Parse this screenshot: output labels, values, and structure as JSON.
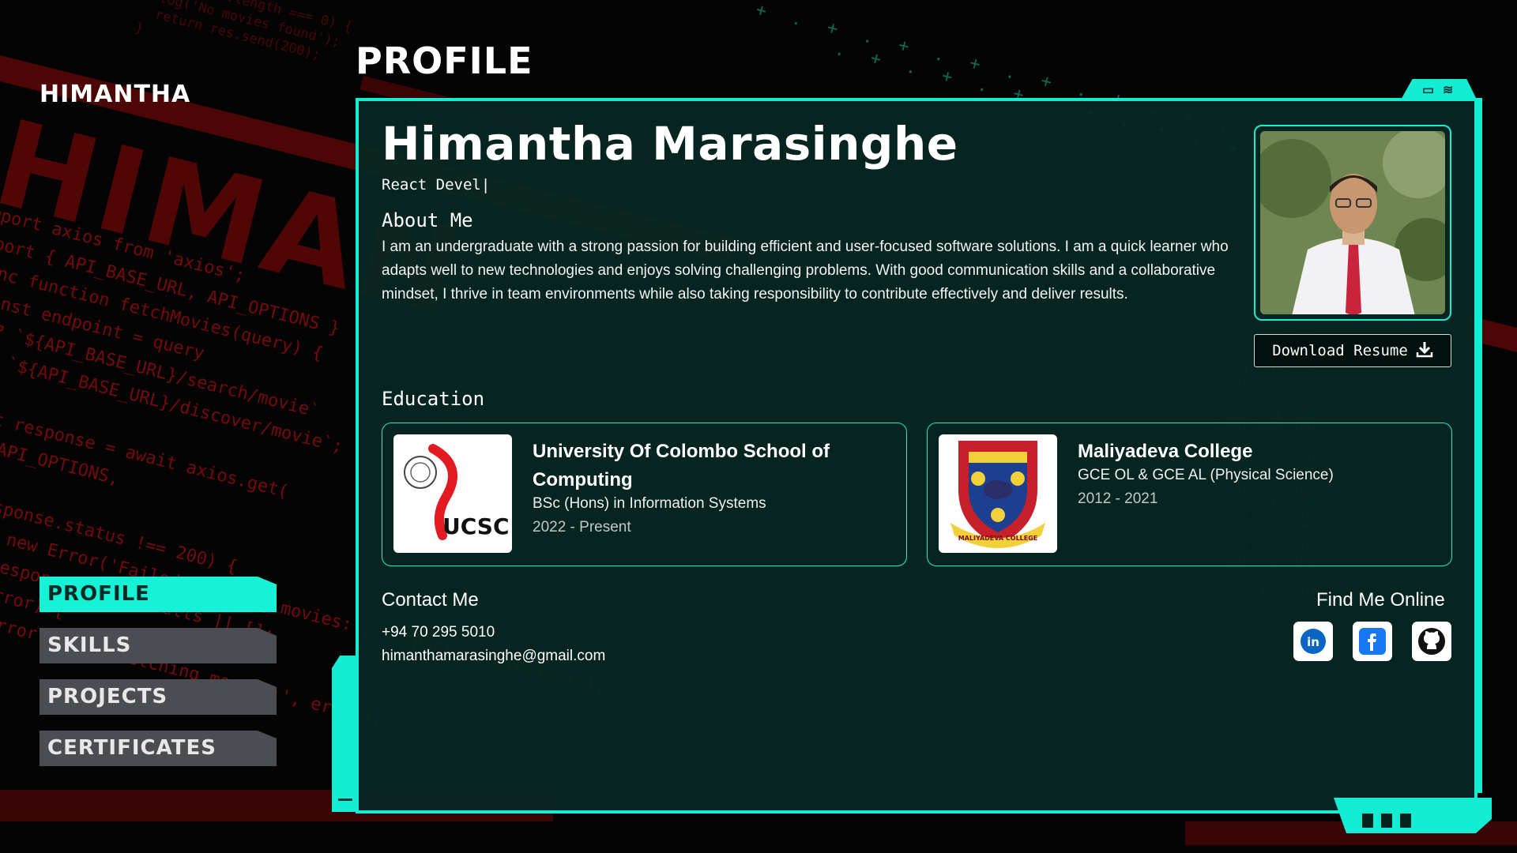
{
  "brand": "HIMANTHA",
  "page_heading": "PROFILE",
  "nav": {
    "items": [
      {
        "label": "PROFILE",
        "active": true
      },
      {
        "label": "SKILLS",
        "active": false
      },
      {
        "label": "PROJECTS",
        "active": false
      },
      {
        "label": "CERTIFICATES",
        "active": false
      }
    ]
  },
  "profile": {
    "name": "Himantha Marasinghe",
    "role_typed": "React Devel|",
    "about_title": "About Me",
    "about_text": "I am an undergraduate with a strong passion for building efficient and user-focused software solutions. I am a quick learner who adapts well to new technologies and enjoys solving challenging problems. With good communication skills and a collaborative mindset, I thrive in team environments while also taking responsibility to contribute effectively and deliver results.",
    "resume_button": "Download Resume"
  },
  "education": {
    "title": "Education",
    "entries": [
      {
        "school": "University Of Colombo School of Computing",
        "degree": "BSc (Hons) in Information Systems",
        "years": "2022 - Present",
        "logo_text": "UCSC"
      },
      {
        "school": "Maliyadeva College",
        "degree": "GCE OL & GCE AL (Physical Science)",
        "years": "2012 - 2021",
        "logo_text": "MALIYADEVA COLLEGE"
      }
    ]
  },
  "contact": {
    "title": "Contact Me",
    "phone": "+94 70 295 5010",
    "email": "himanthamarasinghe@gmail.com"
  },
  "online": {
    "title": "Find Me Online",
    "links": [
      "linkedin-icon",
      "facebook-icon",
      "github-icon"
    ]
  },
  "colors": {
    "accent": "#14ecd4",
    "panel": "#062824",
    "nav_inactive": "#4b4d53",
    "bg_red": "#7a0c0c"
  }
}
